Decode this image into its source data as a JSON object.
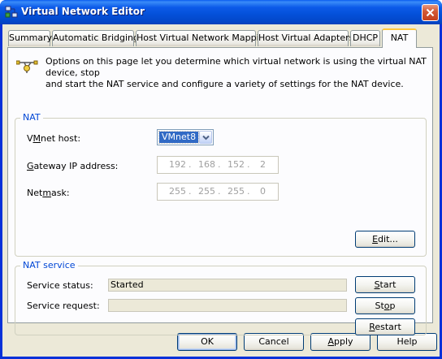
{
  "window": {
    "title": "Virtual Network Editor"
  },
  "tabs": [
    {
      "label": "Summary"
    },
    {
      "label": "Automatic Bridging"
    },
    {
      "label": "Host Virtual Network Mapping"
    },
    {
      "label": "Host Virtual Adapters"
    },
    {
      "label": "DHCP"
    },
    {
      "label": "NAT"
    }
  ],
  "active_tab": "NAT",
  "info": {
    "line1": "Options on this page let you determine which virtual network is using the virtual NAT device, stop",
    "line2": "and start the NAT service and configure a variety of settings for the NAT device."
  },
  "nat_group": {
    "legend": "NAT",
    "vmnet_host": {
      "label_pre": "V",
      "label_ul": "M",
      "label_post": "net host:",
      "value": "VMnet8"
    },
    "gateway": {
      "label_pre": "",
      "label_ul": "G",
      "label_post": "ateway IP address:",
      "octets": [
        "192",
        "168",
        "152",
        "2"
      ]
    },
    "netmask": {
      "label_pre": "Net",
      "label_ul": "m",
      "label_post": "ask:",
      "octets": [
        "255",
        "255",
        "255",
        "0"
      ]
    },
    "edit_button": {
      "pre": "",
      "ul": "E",
      "post": "dit..."
    }
  },
  "service_group": {
    "legend": "NAT service",
    "status_label": "Service status:",
    "status_value": "Started",
    "request_label": "Service request:",
    "request_value": "",
    "start_button": {
      "pre": "",
      "ul": "S",
      "post": "tart"
    },
    "stop_button": {
      "pre": "St",
      "ul": "o",
      "post": "p"
    },
    "restart_button": {
      "pre": "",
      "ul": "R",
      "post": "estart"
    }
  },
  "footer": {
    "ok": "OK",
    "cancel": "Cancel",
    "apply": {
      "pre": "",
      "ul": "A",
      "post": "pply"
    },
    "help": "Help"
  },
  "colors": {
    "title_bar": "#0a5cf1",
    "group_legend": "#0046d5",
    "selected_value_bg": "#316ac5",
    "active_tab_accent": "#ffc83c",
    "close_button": "#d35a36"
  },
  "icons": {
    "app": "network-editor-icon",
    "close": "close-icon",
    "info": "network-connector-icon",
    "dropdown": "chevron-down-icon"
  }
}
